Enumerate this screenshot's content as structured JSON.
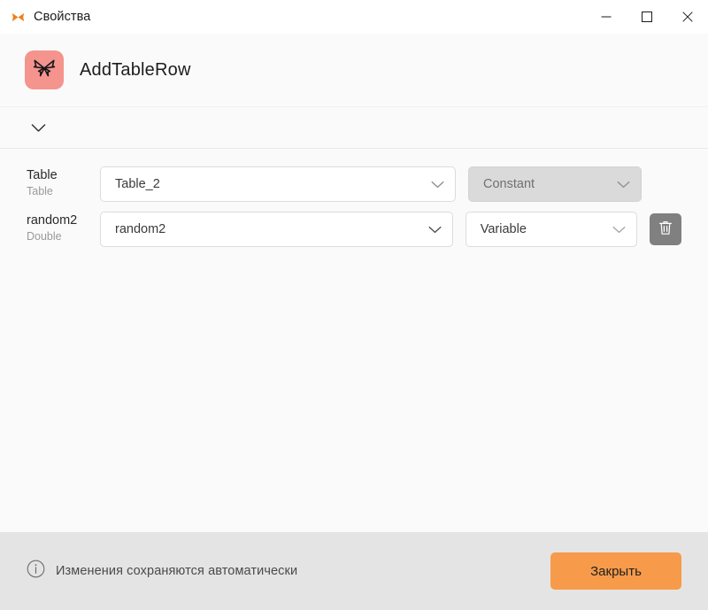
{
  "window": {
    "title": "Свойства",
    "title_icon": "butterfly-icon",
    "controls": {
      "minimize": "minimize-icon",
      "maximize": "maximize-icon",
      "close": "close-icon"
    }
  },
  "header": {
    "badge_icon": "butterfly-icon",
    "badge_color": "#f4948d",
    "title": "AddTableRow"
  },
  "expander": {
    "icon": "chevron-down-icon",
    "state": "collapsed"
  },
  "parameters": [
    {
      "label": "Table",
      "type": "Table",
      "value": "Table_2",
      "value_icon": "chevron-down-icon",
      "kind": "Constant",
      "kind_icon": "chevron-down-icon",
      "kind_disabled": true,
      "deletable": false
    },
    {
      "label": "random2",
      "type": "Double",
      "value": "random2",
      "value_icon": "chevron-down-icon",
      "kind": "Variable",
      "kind_icon": "chevron-down-icon",
      "kind_disabled": false,
      "deletable": true,
      "delete_icon": "trash-icon"
    }
  ],
  "footer": {
    "info_icon": "info-icon",
    "note": "Изменения сохраняются автоматически",
    "close_label": "Закрыть",
    "close_color": "#f79b4a"
  }
}
